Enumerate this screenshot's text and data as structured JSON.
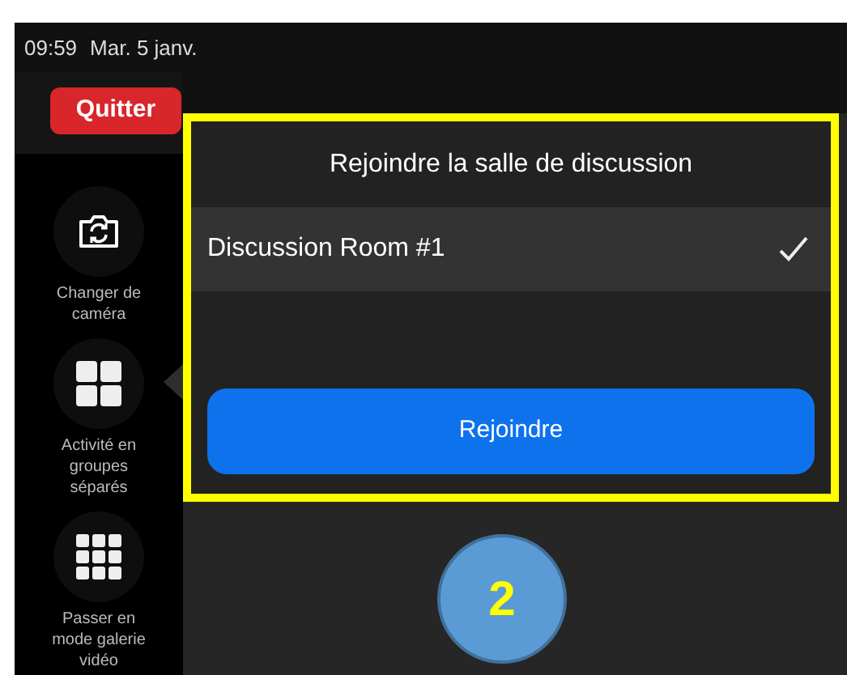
{
  "status_bar": {
    "time": "09:59",
    "date": "Mar. 5 janv."
  },
  "quit_button": "Quitter",
  "sidebar": {
    "items": [
      {
        "kind": "camera",
        "label": "Changer de caméra",
        "selected": false
      },
      {
        "kind": "breakout",
        "label": "Activité en groupes séparés",
        "selected": true
      },
      {
        "kind": "gallery",
        "label": "Passer en mode galerie vidéo",
        "selected": false
      }
    ]
  },
  "dialog": {
    "title": "Rejoindre la salle de discussion",
    "rooms": [
      {
        "name": "Discussion Room #1",
        "selected": true
      }
    ],
    "join_button": "Rejoindre"
  },
  "step_badge": "2"
}
